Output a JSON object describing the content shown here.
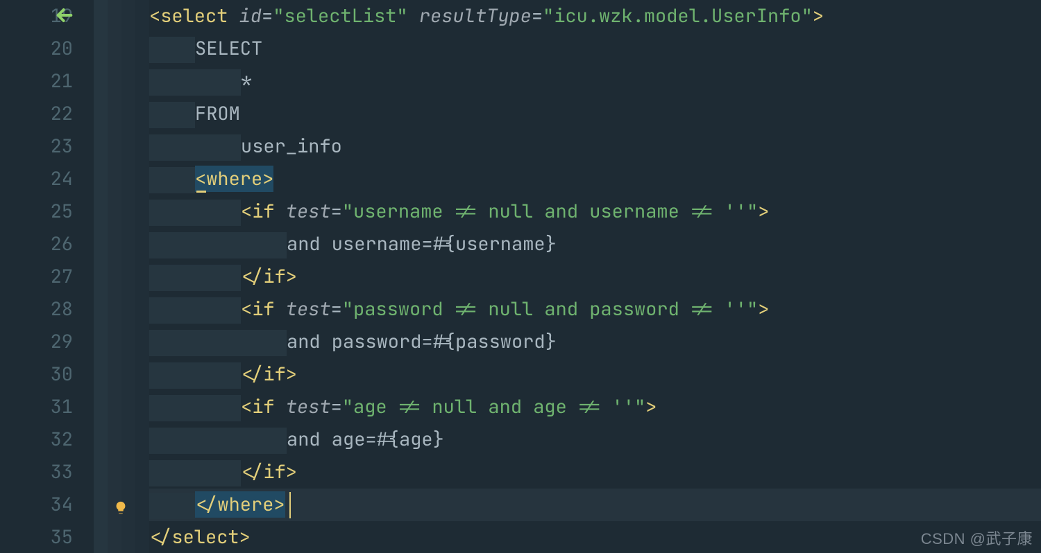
{
  "lineNumbers": [
    "19",
    "20",
    "21",
    "22",
    "23",
    "24",
    "25",
    "26",
    "27",
    "28",
    "29",
    "30",
    "31",
    "32",
    "33",
    "34",
    "35"
  ],
  "code": {
    "l19": {
      "tagOpen": "<select",
      "attr1": "id",
      "eq1": "=",
      "val1": "\"selectList\"",
      "attr2": "resultType",
      "eq2": "=",
      "val2": "\"icu.wzk.model.UserInfo\"",
      "close": ">"
    },
    "l20": {
      "text": "SELECT"
    },
    "l21": {
      "text": "*"
    },
    "l22": {
      "text": "FROM"
    },
    "l23": {
      "text": "user_info"
    },
    "l24": {
      "tag": "<where>"
    },
    "l25": {
      "tagOpen": "<if",
      "attr": "test",
      "eq": "=",
      "val": "\"username != null and username != ''\"",
      "close": ">"
    },
    "l26": {
      "text": "and username=#{username}"
    },
    "l27": {
      "tag": "</if>"
    },
    "l28": {
      "tagOpen": "<if",
      "attr": "test",
      "eq": "=",
      "val": "\"password != null and password != ''\"",
      "close": ">"
    },
    "l29": {
      "text": "and password=#{password}"
    },
    "l30": {
      "tag": "</if>"
    },
    "l31": {
      "tagOpen": "<if",
      "attr": "test",
      "eq": "=",
      "val": "\"age != null and age != ''\"",
      "close": ">"
    },
    "l32": {
      "text": "and age=#{age}"
    },
    "l33": {
      "tag": "</if>"
    },
    "l34": {
      "tag": "</where>"
    },
    "l35": {
      "tag": "</select>"
    }
  },
  "icons": {
    "backArrow": "arrow-left",
    "bulb": "lightbulb"
  },
  "watermark": "CSDN @武子康"
}
